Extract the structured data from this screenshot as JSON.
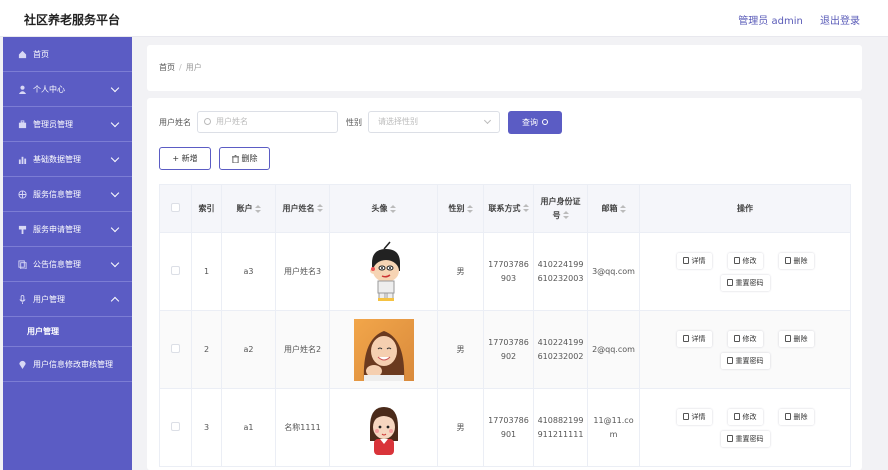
{
  "app": {
    "title": "社区养老服务平台",
    "admin_label": "管理员 admin",
    "logout_label": "退出登录"
  },
  "sidebar": {
    "items": [
      {
        "label": "首页",
        "icon": "home-icon"
      },
      {
        "label": "个人中心",
        "icon": "user-icon"
      },
      {
        "label": "管理员管理",
        "icon": "briefcase-icon"
      },
      {
        "label": "基础数据管理",
        "icon": "bar-chart-icon"
      },
      {
        "label": "服务信息管理",
        "icon": "globe-icon"
      },
      {
        "label": "服务申请管理",
        "icon": "clipboard-icon"
      },
      {
        "label": "公告信息管理",
        "icon": "copy-icon"
      },
      {
        "label": "用户管理",
        "icon": "mic-icon"
      },
      {
        "label": "用户信息修改审核管理",
        "icon": "location-icon"
      }
    ],
    "sub_item": "用户管理"
  },
  "breadcrumb": {
    "home": "首页",
    "separator": "/",
    "current": "用户"
  },
  "search": {
    "name_label": "用户姓名",
    "name_placeholder": "用户姓名",
    "gender_label": "性别",
    "gender_placeholder": "请选择性别",
    "query_label": "查询"
  },
  "actions": {
    "add_label": "+ 新增",
    "delete_label": "删除"
  },
  "table": {
    "headers": {
      "index": "索引",
      "account": "账户",
      "name": "用户姓名",
      "avatar": "头像",
      "gender": "性别",
      "phone": "联系方式",
      "idcard": "用户身份证号",
      "email": "邮箱",
      "ops": "操作"
    },
    "op_labels": {
      "detail": "详情",
      "edit": "修改",
      "delete": "删除",
      "reset": "重置密码"
    },
    "rows": [
      {
        "index": "1",
        "account": "a3",
        "name": "用户姓名3",
        "avatar": "cartoon-boy",
        "gender": "男",
        "phone": "17703786903",
        "idcard": "410224199610232003",
        "email": "3@qq.com"
      },
      {
        "index": "2",
        "account": "a2",
        "name": "用户姓名2",
        "avatar": "smiling-woman-photo",
        "gender": "男",
        "phone": "17703786902",
        "idcard": "410224199610232002",
        "email": "2@qq.com"
      },
      {
        "index": "3",
        "account": "a1",
        "name": "名称1111",
        "avatar": "cartoon-girl",
        "gender": "男",
        "phone": "17703786901",
        "idcard": "410882199911211111",
        "email": "11@11.com"
      }
    ]
  },
  "colors": {
    "accent": "#5b5cc4",
    "sidebar": "#5b5cc4"
  }
}
